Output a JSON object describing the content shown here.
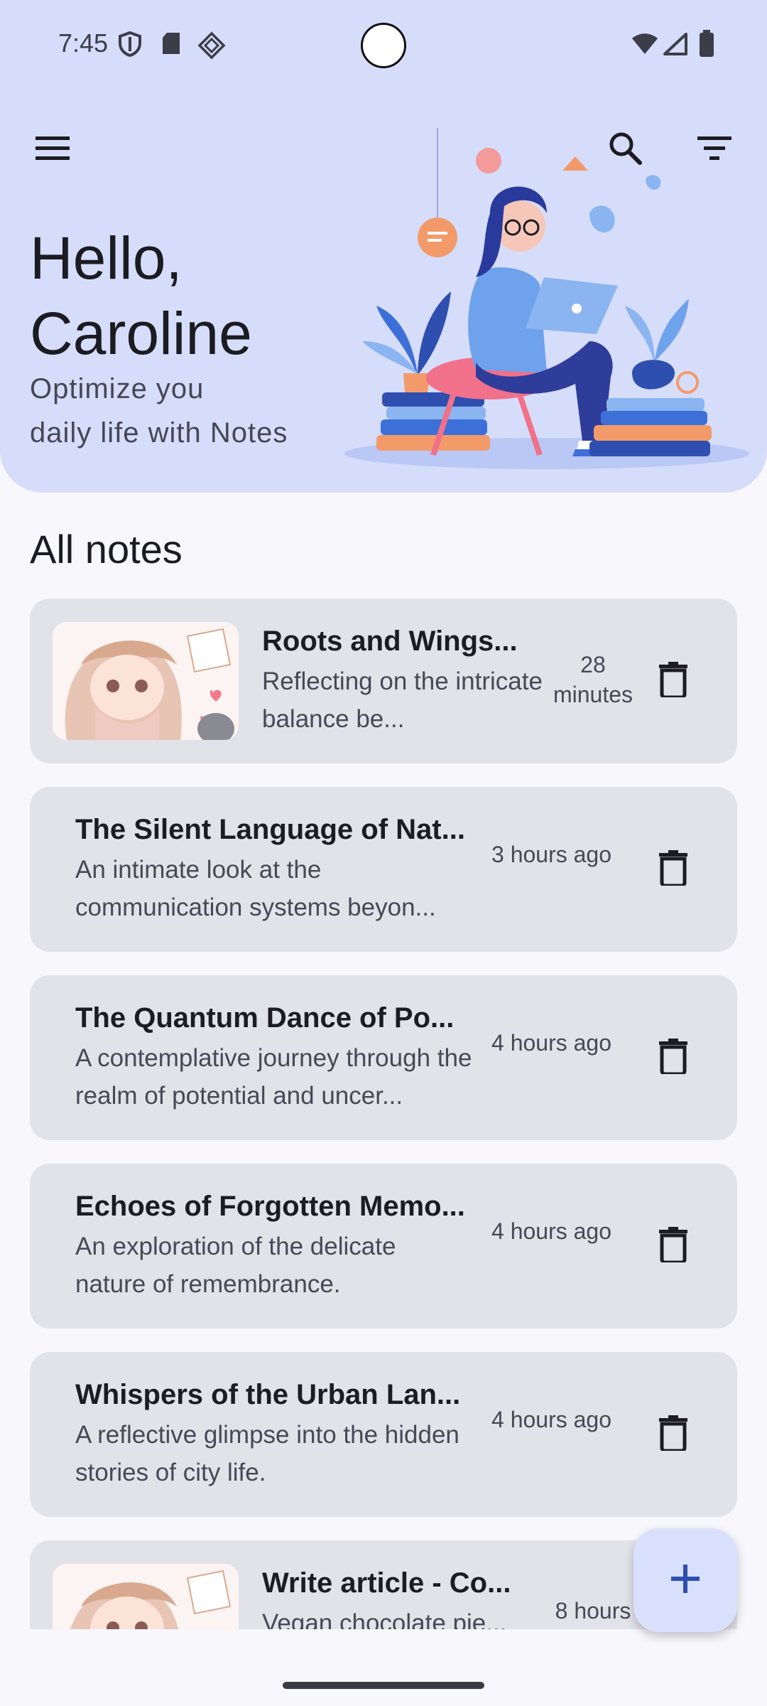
{
  "status_bar": {
    "time": "7:45"
  },
  "header": {
    "greeting": "Hello,\nCaroline",
    "subtitle": "Optimize you\n daily life with Notes"
  },
  "section_title": "All notes",
  "notes": [
    {
      "title": "Roots and Wings...",
      "desc": "Reflecting on the intricate balance be...",
      "time": "28\nminutes",
      "has_image": true
    },
    {
      "title": "The Silent Language of Nat...",
      "desc": "An intimate look at the communication systems beyon...",
      "time": "3 hours ago",
      "has_image": false
    },
    {
      "title": "The Quantum Dance of Po...",
      "desc": "A contemplative journey through the realm of potential and uncer...",
      "time": "4 hours ago",
      "has_image": false
    },
    {
      "title": "Echoes of Forgotten Memo...",
      "desc": "An exploration of the delicate nature of remembrance.",
      "time": "4 hours ago",
      "has_image": false
    },
    {
      "title": "Whispers of the Urban Lan...",
      "desc": "A reflective glimpse into the hidden stories of city life.",
      "time": "4 hours ago",
      "has_image": false
    },
    {
      "title": "Write article - Co...",
      "desc": "Vegan chocolate pie...",
      "time": "8 hours",
      "has_image": true
    }
  ],
  "colors": {
    "header_bg": "#d6ddfb",
    "card_bg": "#e2e2e9",
    "fab_bg": "#d9e0fb",
    "accent": "#2f4fb0"
  },
  "icons": {
    "menu": "menu-icon",
    "search": "search-icon",
    "filter": "filter-icon",
    "delete": "trash-icon",
    "add": "plus-icon"
  }
}
